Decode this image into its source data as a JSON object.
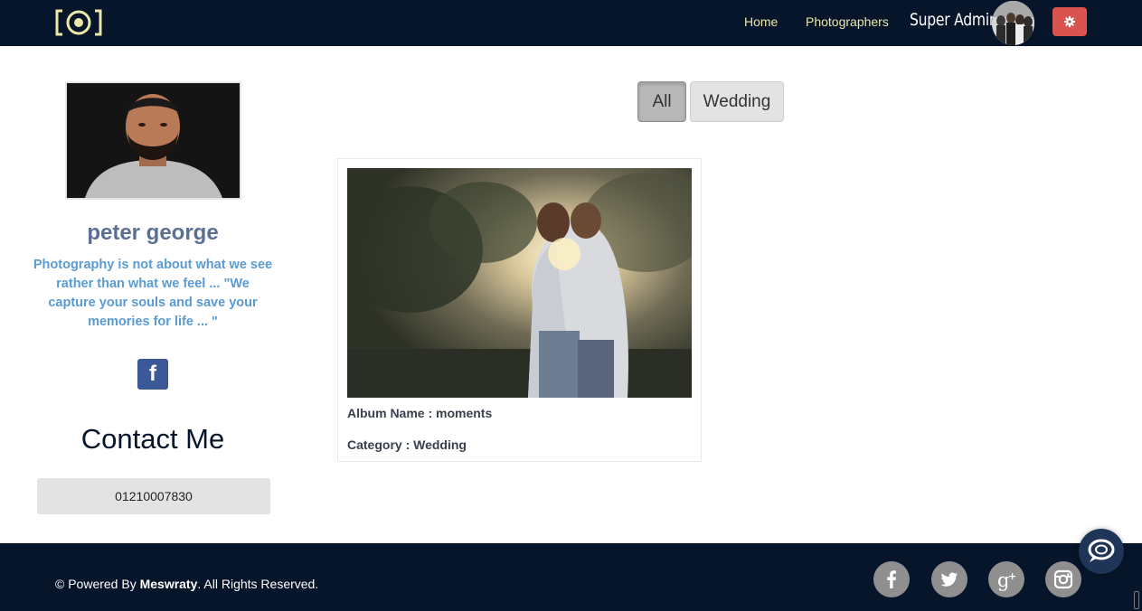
{
  "navbar": {
    "logo_icon": "camera-lens-logo-icon",
    "links": [
      {
        "label": "Home"
      },
      {
        "label": "Photographers"
      }
    ],
    "user_name": "Super Admin",
    "settings_icon": "gear-icon",
    "colors": {
      "background": "#06152a",
      "link": "#ece8a8",
      "settings_button": "#d9534f"
    }
  },
  "profile": {
    "name": "peter george",
    "quote": "Photography is not about what we see rather than what we feel ... \"We capture your souls and save your memories for life ... \"",
    "social_icon": "facebook-icon",
    "contact_title": "Contact Me",
    "phone": "01210007830",
    "colors": {
      "name": "#5b6f94",
      "quote": "#5b9bd3"
    }
  },
  "filters": {
    "items": [
      {
        "label": "All",
        "active": true
      },
      {
        "label": "Wedding",
        "active": false
      }
    ]
  },
  "albums": [
    {
      "name_label": "Album Name : moments",
      "category_label": "Category : Wedding"
    }
  ],
  "footer": {
    "copyright_prefix": "© Powered By ",
    "brand": "Meswraty",
    "copyright_suffix": ". All Rights Reserved.",
    "social_icons": [
      "facebook-icon",
      "twitter-icon",
      "google-plus-icon",
      "instagram-icon"
    ],
    "chat_icon": "chat-bubble-icon"
  }
}
